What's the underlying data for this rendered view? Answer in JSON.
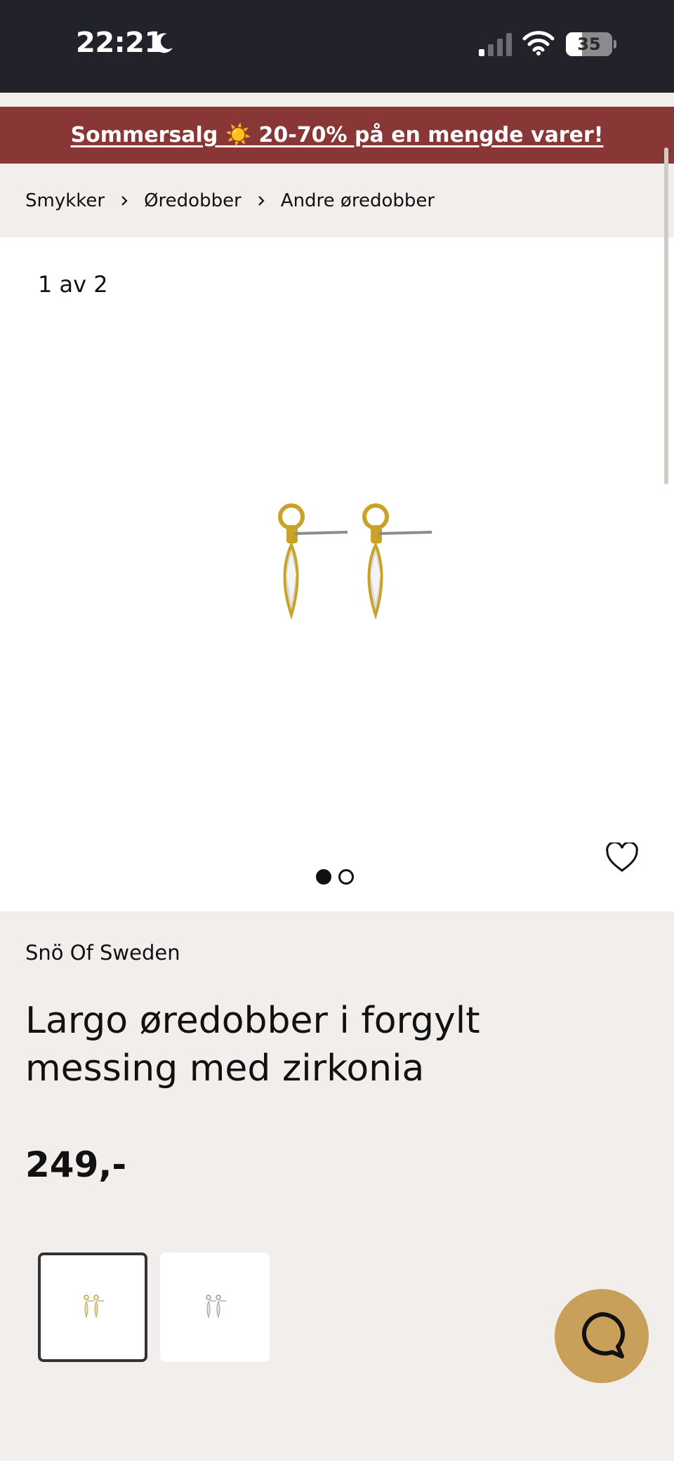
{
  "status_bar": {
    "time": "22:21",
    "battery": "35",
    "battery_level": 0.35,
    "icons": [
      "moon-icon",
      "cellular-signal-icon",
      "wifi-icon",
      "battery-icon"
    ]
  },
  "banner": {
    "text": "Sommersalg ☀️ 20-70% på en mengde varer!",
    "background": "#883636"
  },
  "breadcrumb": {
    "items": [
      "Smykker",
      "Øredobber",
      "Andre øredobber"
    ]
  },
  "gallery": {
    "counter": "1 av 2",
    "current": 1,
    "total": 2
  },
  "product": {
    "brand": "Snö Of Sweden",
    "title": "Largo øredobber i forgylt messing med zirkonia",
    "price": "249,-"
  },
  "thumbnails": [
    {
      "variant": "gold",
      "selected": true
    },
    {
      "variant": "silver",
      "selected": false
    }
  ],
  "colors": {
    "accent_chat": "#c9a059",
    "status_bar": "#22232a",
    "page_background": "#f1eeeb"
  }
}
